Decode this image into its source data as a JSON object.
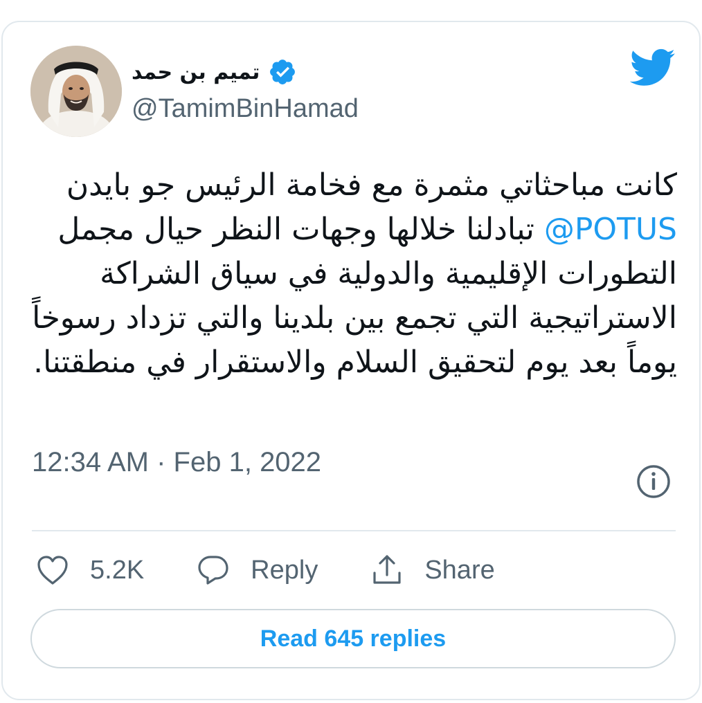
{
  "tweet": {
    "author": {
      "display_name": "تميم بن حمد",
      "handle": "@TamimBinHamad",
      "verified": true
    },
    "text_part1": "كانت مباحثاتي مثمرة مع فخامة الرئيس جو بايدن ",
    "mention": "@POTUS",
    "text_part2": " تبادلنا خلالها وجهات النظر حيال مجمل التطورات الإقليمية والدولية في سياق الشراكة الاستراتيجية التي تجمع بين بلدينا والتي تزداد رسوخاً يوماً بعد يوم لتحقيق السلام والاستقرار في منطقتنا.",
    "timestamp": "12:34 AM · Feb 1, 2022",
    "actions": {
      "like_count": "5.2K",
      "reply_label": "Reply",
      "share_label": "Share"
    },
    "read_replies": "Read 645 replies"
  },
  "icons": {
    "logo": "twitter-bird-icon",
    "verified": "verified-badge-icon",
    "info": "info-icon",
    "like": "heart-icon",
    "reply": "speech-bubble-icon",
    "share": "share-upload-icon"
  },
  "colors": {
    "accent": "#1d9bf0",
    "text_primary": "#0f1419",
    "text_secondary": "#536471",
    "border": "#e1e8ed"
  }
}
